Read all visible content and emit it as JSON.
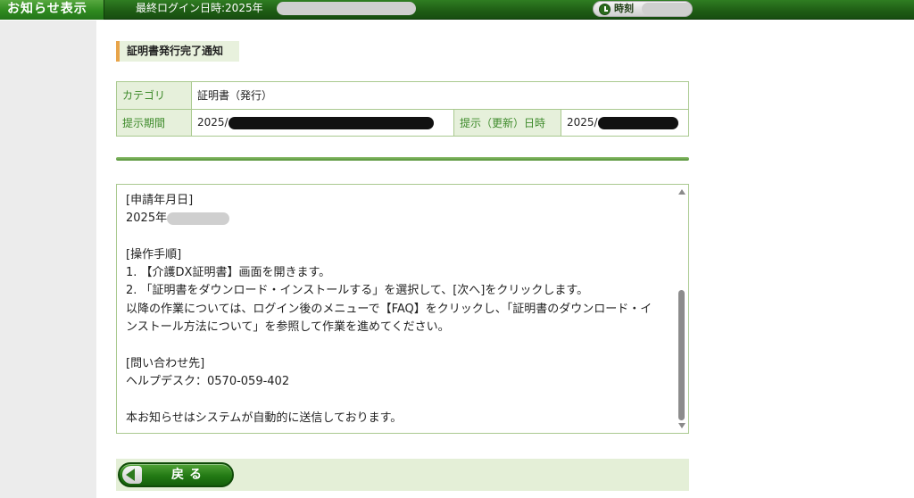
{
  "header": {
    "title": "お知らせ表示",
    "last_login_label": "最終ログイン日時:2025年",
    "clock_label": "時刻"
  },
  "notice": {
    "heading": "証明書発行完了通知"
  },
  "info_table": {
    "category_label": "カテゴリ",
    "category_value": "証明書（発行）",
    "period_label": "提示期間",
    "period_value_prefix": "2025/",
    "updated_label": "提示（更新）日時",
    "updated_value_prefix": "2025/"
  },
  "message": {
    "lines": [
      "[申請年月日]",
      "2025年",
      "",
      "[操作手順]",
      "1. 【介護DX証明書】画面を開きます。",
      "2. 「証明書をダウンロード・インストールする」を選択して、[次へ]をクリックします。",
      "以降の作業については、ログイン後のメニューで【FAQ】をクリックし、「証明書のダウンロード・イ",
      "ンストール方法について」を参照して作業を進めてください。",
      "",
      "[問い合わせ先]",
      "ヘルプデスク：0570-059-402",
      "",
      "本お知らせはシステムが自動的に送信しております。"
    ]
  },
  "nav": {
    "back_label": "戻る"
  },
  "icons": {
    "clock": "clock-icon",
    "back": "back-arrow-icon",
    "scroll_up": "scroll-up-arrow-icon",
    "scroll_down": "scroll-down-arrow-icon"
  },
  "colors": {
    "header_green": "#1e5c14",
    "accent_orange": "#e8a44a",
    "label_green": "#3d8a2a",
    "light_green_bg": "#e6f0db"
  }
}
